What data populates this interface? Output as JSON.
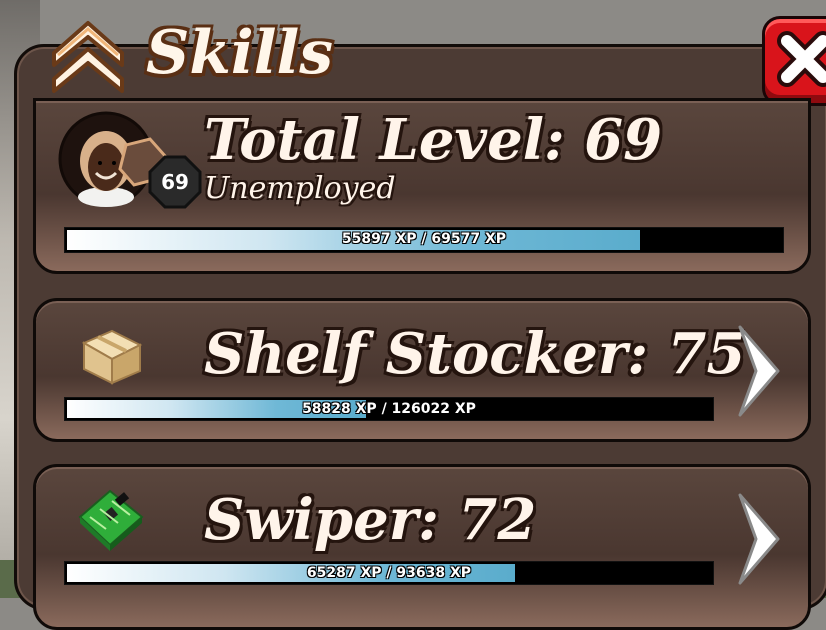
{
  "header": {
    "title": "Skills",
    "icon": "double-chevron-up-icon",
    "close_icon": "close-icon"
  },
  "total": {
    "label": "Total Level: 69",
    "badge_level": "69",
    "job": "Unemployed",
    "xp_text": "55897 XP / 69577 XP",
    "progress": 0.803
  },
  "skills": [
    {
      "name_label": "Shelf Stocker: 75",
      "icon": "cardboard-box-icon",
      "xp_text": "58828 XP / 126022 XP",
      "progress": 0.467
    },
    {
      "name_label": "Swiper: 72",
      "icon": "circuit-board-icon",
      "xp_text": "65287 XP / 93638 XP",
      "progress": 0.697
    }
  ],
  "colors": {
    "panel": "#4c3b34",
    "close_red": "#d9141b",
    "xp_fill": "#5aaccc",
    "title_text": "#fff6ea"
  }
}
